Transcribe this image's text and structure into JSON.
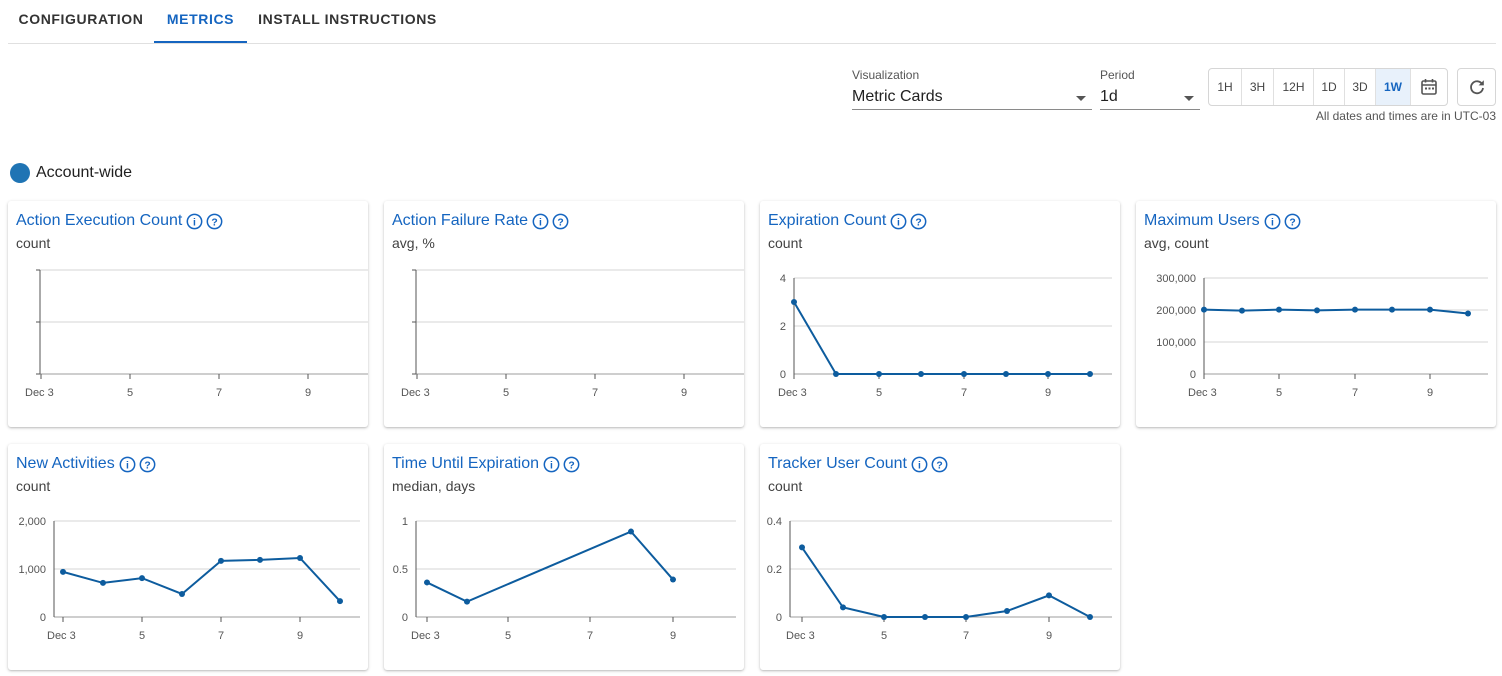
{
  "tabs": [
    {
      "label": "CONFIGURATION",
      "active": false
    },
    {
      "label": "METRICS",
      "active": true
    },
    {
      "label": "INSTALL INSTRUCTIONS",
      "active": false
    }
  ],
  "controls": {
    "visualization_label": "Visualization",
    "visualization_value": "Metric Cards",
    "period_label": "Period",
    "period_value": "1d",
    "ranges": [
      "1H",
      "3H",
      "12H",
      "1D",
      "3D",
      "1W"
    ],
    "active_range": "1W",
    "calendar_icon": "calendar-icon",
    "refresh_icon": "refresh-icon",
    "timezone_note": "All dates and times are in UTC-03"
  },
  "account": {
    "label": "Account-wide",
    "color": "#1f74b4"
  },
  "colors": {
    "accent": "#1565c0",
    "line": "#0d5c9e"
  },
  "cards": [
    {
      "title": "Action Execution Count",
      "subtitle": "count",
      "chart_data": {
        "type": "line",
        "x_ticks": [
          "Dec 3",
          "5",
          "7",
          "9"
        ],
        "y_ticks": [],
        "ylim": [
          0,
          1
        ],
        "x": [],
        "y": [],
        "grid": true
      }
    },
    {
      "title": "Action Failure Rate",
      "subtitle": "avg, %",
      "chart_data": {
        "type": "line",
        "x_ticks": [
          "Dec 3",
          "5",
          "7",
          "9"
        ],
        "y_ticks": [],
        "ylim": [
          0,
          1
        ],
        "x": [],
        "y": [],
        "grid": true
      }
    },
    {
      "title": "Expiration Count",
      "subtitle": "count",
      "chart_data": {
        "type": "line",
        "x_ticks": [
          "Dec 3",
          "5",
          "7",
          "9"
        ],
        "y_ticks": [
          "0",
          "2",
          "4"
        ],
        "ylim": [
          0,
          4
        ],
        "x": [
          "Dec 3",
          "Dec 4",
          "Dec 5",
          "Dec 6",
          "Dec 7",
          "Dec 8",
          "Dec 9",
          "Dec 10"
        ],
        "y": [
          3,
          0,
          0,
          0,
          0,
          0,
          0,
          0
        ],
        "grid": true
      }
    },
    {
      "title": "Maximum Users",
      "subtitle": "avg, count",
      "chart_data": {
        "type": "line",
        "x_ticks": [
          "Dec 3",
          "5",
          "7",
          "9"
        ],
        "y_ticks": [
          "0",
          "100,000",
          "200,000",
          "300,000"
        ],
        "ylim": [
          0,
          300000
        ],
        "x": [
          "Dec 3",
          "Dec 4",
          "Dec 5",
          "Dec 6",
          "Dec 7",
          "Dec 8",
          "Dec 9",
          "Dec 10"
        ],
        "y": [
          201000,
          198000,
          201000,
          199000,
          201000,
          201000,
          201000,
          189000
        ],
        "grid": true
      }
    },
    {
      "title": "New Activities",
      "subtitle": "count",
      "chart_data": {
        "type": "line",
        "x_ticks": [
          "Dec 3",
          "5",
          "7",
          "9"
        ],
        "y_ticks": [
          "0",
          "1,000",
          "2,000"
        ],
        "ylim": [
          0,
          2000
        ],
        "x": [
          "Dec 3",
          "Dec 4",
          "Dec 5",
          "Dec 6",
          "Dec 7",
          "Dec 8",
          "Dec 9",
          "Dec 10"
        ],
        "y": [
          940,
          710,
          810,
          480,
          1170,
          1190,
          1230,
          330
        ],
        "grid": true
      }
    },
    {
      "title": "Time Until Expiration",
      "subtitle": "median, days",
      "chart_data": {
        "type": "line",
        "x_ticks": [
          "Dec 3",
          "5",
          "7",
          "9"
        ],
        "y_ticks": [
          "0",
          "0.5",
          "1"
        ],
        "ylim": [
          0,
          1
        ],
        "x": [
          "Dec 3",
          "Dec 4",
          "Dec 8",
          "Dec 9"
        ],
        "y": [
          0.36,
          0.16,
          0.89,
          0.39
        ],
        "grid": true
      }
    },
    {
      "title": "Tracker User Count",
      "subtitle": "count",
      "chart_data": {
        "type": "line",
        "x_ticks": [
          "Dec 3",
          "5",
          "7",
          "9"
        ],
        "y_ticks": [
          "0",
          "0.2",
          "0.4"
        ],
        "ylim": [
          0,
          0.4
        ],
        "x": [
          "Dec 3",
          "Dec 4",
          "Dec 5",
          "Dec 6",
          "Dec 7",
          "Dec 8",
          "Dec 9",
          "Dec 10"
        ],
        "y": [
          0.29,
          0.04,
          0,
          0,
          0,
          0.025,
          0.09,
          0
        ],
        "grid": true
      }
    }
  ]
}
